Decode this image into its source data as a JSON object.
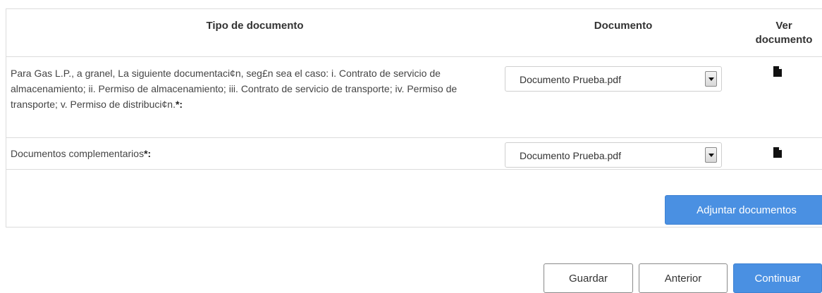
{
  "table": {
    "headers": {
      "tipo": "Tipo de documento",
      "documento": "Documento",
      "ver_line1": "Ver",
      "ver_line2": "documento"
    },
    "rows": [
      {
        "description": "Para Gas L.P., a granel, La siguiente documentaci¢n, seg£n sea el caso: i. Contrato de servicio de almacenamiento; ii. Permiso de almacenamiento; iii. Contrato de servicio de transporte; iv. Permiso de transporte; v. Permiso de distribuci¢n.",
        "required_mark": "*:",
        "selected_document": "Documento Prueba.pdf",
        "view_icon": "file-icon"
      },
      {
        "description": "Documentos complementarios",
        "required_mark": "*:",
        "selected_document": "Documento Prueba.pdf",
        "view_icon": "file-icon"
      }
    ]
  },
  "actions": {
    "adjuntar": "Adjuntar documentos",
    "guardar": "Guardar",
    "anterior": "Anterior",
    "continuar": "Continuar"
  },
  "colors": {
    "primary": "#4a90e2",
    "border": "#dcdcdc"
  }
}
